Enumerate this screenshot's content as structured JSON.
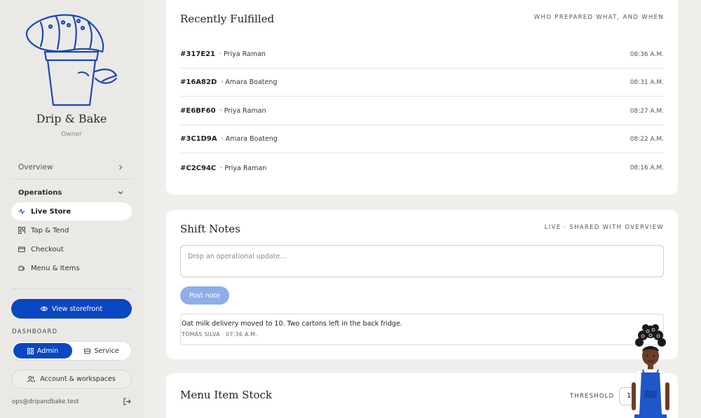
{
  "sidebar": {
    "brand": "Drip & Bake",
    "role": "Owner",
    "overview_label": "Overview",
    "section_label": "Operations",
    "items": [
      {
        "label": "Live Store",
        "icon": "activity-icon",
        "active": true
      },
      {
        "label": "Tap & Tend",
        "icon": "qr-icon",
        "active": false
      },
      {
        "label": "Checkout",
        "icon": "card-icon",
        "active": false
      },
      {
        "label": "Menu & Items",
        "icon": "cup-icon",
        "active": false
      }
    ],
    "storefront_button": "View storefront",
    "dashboard_label": "DASHBOARD",
    "dashboard_options": [
      "Admin",
      "Service"
    ],
    "account_button": "Account & workspaces",
    "email": "ops@dripandbake.test"
  },
  "fulfilled": {
    "title": "Recently Fulfilled",
    "meta": "WHO PREPARED WHAT, AND WHEN",
    "rows": [
      {
        "id": "#317E21",
        "who": "· Priya Raman",
        "time": "08:36 A.M."
      },
      {
        "id": "#16A82D",
        "who": "· Amara Boateng",
        "time": "08:31 A.M."
      },
      {
        "id": "#E6BF60",
        "who": "· Priya Raman",
        "time": "08:27 A.M."
      },
      {
        "id": "#3C1D9A",
        "who": "· Amara Boateng",
        "time": "08:22 A.M."
      },
      {
        "id": "#C2C94C",
        "who": "· Priya Raman",
        "time": "08:16 A.M."
      }
    ]
  },
  "shift_notes": {
    "title": "Shift Notes",
    "meta": "LIVE · SHARED WITH OVERVIEW",
    "placeholder": "Drop an operational update...",
    "post_button": "Post note",
    "note_text": "Oat milk delivery moved to 10. Two cartons left in the back fridge.",
    "note_meta": "TOMÁS SILVA · 07:36 A.M."
  },
  "stock": {
    "title": "Menu Item Stock",
    "threshold_label": "THRESHOLD",
    "threshold_value": "1"
  },
  "colors": {
    "accent": "#0b47c1",
    "accent_light": "#8eaee9",
    "logo_stroke": "#1a47b8"
  }
}
